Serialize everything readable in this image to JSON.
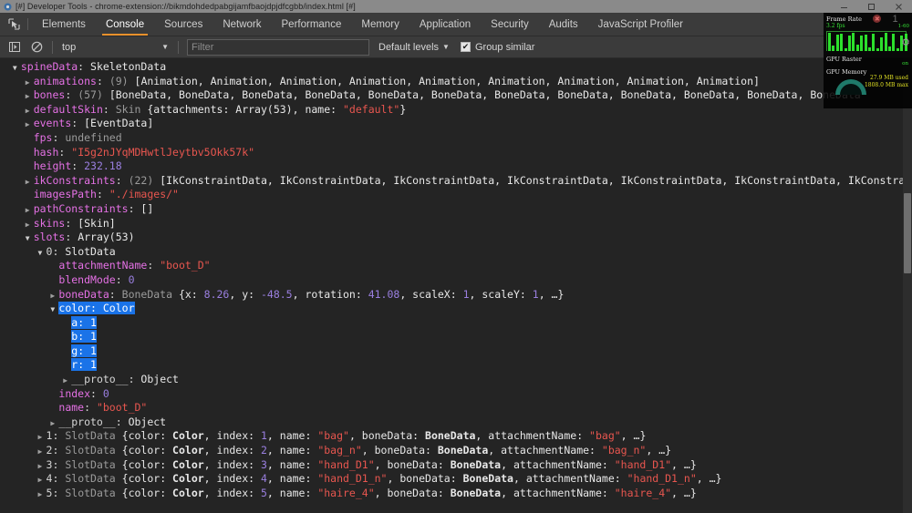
{
  "window": {
    "title": "[#] Developer Tools - chrome-extension://bikmdohdedpabgijamfbaojdpjdfcgbb/index.html [#]",
    "minimize_label": "–",
    "maximize_label": "□",
    "close_label": "✕"
  },
  "tabs": [
    {
      "label": "Elements",
      "active": false
    },
    {
      "label": "Console",
      "active": true
    },
    {
      "label": "Sources",
      "active": false
    },
    {
      "label": "Network",
      "active": false
    },
    {
      "label": "Performance",
      "active": false
    },
    {
      "label": "Memory",
      "active": false
    },
    {
      "label": "Application",
      "active": false
    },
    {
      "label": "Security",
      "active": false
    },
    {
      "label": "Audits",
      "active": false
    },
    {
      "label": "JavaScript Profiler",
      "active": false
    }
  ],
  "filterbar": {
    "execute_icon": "execution-context-icon",
    "clear_icon": "clear-console-icon",
    "context_value": "top",
    "filter_placeholder": "Filter",
    "filter_value": "",
    "levels_label": "Default levels",
    "group_similar_label": "Group similar",
    "group_similar_checked": true,
    "checkmark": "✔"
  },
  "accent_color": "#e8912c",
  "selection_color": "#1a73e8",
  "console": {
    "lines": [
      {
        "indent": 1,
        "arrow": "open",
        "segs": [
          {
            "t": "spineData",
            "c": "k-prop"
          },
          {
            "t": ": ",
            "c": "punct"
          },
          {
            "t": "SkeletonData",
            "c": "v-white"
          }
        ]
      },
      {
        "indent": 2,
        "arrow": "closed",
        "segs": [
          {
            "t": "animations",
            "c": "k-prop"
          },
          {
            "t": ": ",
            "c": "punct"
          },
          {
            "t": "(9) ",
            "c": "v-gray"
          },
          {
            "t": "[Animation, Animation, Animation, Animation, Animation, Animation, Animation, Animation, Animation]",
            "c": "v-white"
          }
        ]
      },
      {
        "indent": 2,
        "arrow": "closed",
        "segs": [
          {
            "t": "bones",
            "c": "k-prop"
          },
          {
            "t": ": ",
            "c": "punct"
          },
          {
            "t": "(57) ",
            "c": "v-gray"
          },
          {
            "t": "[BoneData, BoneData, BoneData, BoneData, BoneData, BoneData, BoneData, BoneData, BoneData, BoneData, BoneData, BoneData",
            "c": "v-white"
          }
        ]
      },
      {
        "indent": 2,
        "arrow": "closed",
        "segs": [
          {
            "t": "defaultSkin",
            "c": "k-prop"
          },
          {
            "t": ": ",
            "c": "punct"
          },
          {
            "t": "Skin ",
            "c": "v-class"
          },
          {
            "t": "{attachments: Array(53), name: ",
            "c": "v-white"
          },
          {
            "t": "\"default\"",
            "c": "v-str"
          },
          {
            "t": "}",
            "c": "v-white"
          }
        ]
      },
      {
        "indent": 2,
        "arrow": "closed",
        "segs": [
          {
            "t": "events",
            "c": "k-prop"
          },
          {
            "t": ": ",
            "c": "punct"
          },
          {
            "t": "[EventData]",
            "c": "v-white"
          }
        ]
      },
      {
        "indent": 2,
        "arrow": "none",
        "segs": [
          {
            "t": "fps",
            "c": "k-prop"
          },
          {
            "t": ": ",
            "c": "punct"
          },
          {
            "t": "undefined",
            "c": "v-gray"
          }
        ]
      },
      {
        "indent": 2,
        "arrow": "none",
        "segs": [
          {
            "t": "hash",
            "c": "k-prop"
          },
          {
            "t": ": ",
            "c": "punct"
          },
          {
            "t": "\"I5g2nJYqMDHwtlJeytbv5Okk57k\"",
            "c": "v-str"
          }
        ]
      },
      {
        "indent": 2,
        "arrow": "none",
        "segs": [
          {
            "t": "height",
            "c": "k-prop"
          },
          {
            "t": ": ",
            "c": "punct"
          },
          {
            "t": "232.18",
            "c": "v-num"
          }
        ]
      },
      {
        "indent": 2,
        "arrow": "closed",
        "segs": [
          {
            "t": "ikConstraints",
            "c": "k-prop"
          },
          {
            "t": ": ",
            "c": "punct"
          },
          {
            "t": "(22) ",
            "c": "v-gray"
          },
          {
            "t": "[IkConstraintData, IkConstraintData, IkConstraintData, IkConstraintData, IkConstraintData, IkConstraintData, IkConstraint",
            "c": "v-white"
          }
        ]
      },
      {
        "indent": 2,
        "arrow": "none",
        "segs": [
          {
            "t": "imagesPath",
            "c": "k-prop"
          },
          {
            "t": ": ",
            "c": "punct"
          },
          {
            "t": "\"./images/\"",
            "c": "v-str"
          }
        ]
      },
      {
        "indent": 2,
        "arrow": "closed",
        "segs": [
          {
            "t": "pathConstraints",
            "c": "k-prop"
          },
          {
            "t": ": ",
            "c": "punct"
          },
          {
            "t": "[]",
            "c": "v-white"
          }
        ]
      },
      {
        "indent": 2,
        "arrow": "closed",
        "segs": [
          {
            "t": "skins",
            "c": "k-prop"
          },
          {
            "t": ": ",
            "c": "punct"
          },
          {
            "t": "[Skin]",
            "c": "v-white"
          }
        ]
      },
      {
        "indent": 2,
        "arrow": "open",
        "segs": [
          {
            "t": "slots",
            "c": "k-prop"
          },
          {
            "t": ": ",
            "c": "punct"
          },
          {
            "t": "Array(53)",
            "c": "v-white"
          }
        ]
      },
      {
        "indent": 3,
        "arrow": "open",
        "segs": [
          {
            "t": "0",
            "c": "k-idx"
          },
          {
            "t": ": ",
            "c": "punct"
          },
          {
            "t": "SlotData",
            "c": "v-white"
          }
        ]
      },
      {
        "indent": 4,
        "arrow": "none",
        "segs": [
          {
            "t": "attachmentName",
            "c": "k-prop"
          },
          {
            "t": ": ",
            "c": "punct"
          },
          {
            "t": "\"boot_D\"",
            "c": "v-str"
          }
        ]
      },
      {
        "indent": 4,
        "arrow": "none",
        "segs": [
          {
            "t": "blendMode",
            "c": "k-prop"
          },
          {
            "t": ": ",
            "c": "punct"
          },
          {
            "t": "0",
            "c": "v-num"
          }
        ]
      },
      {
        "indent": 4,
        "arrow": "closed",
        "segs": [
          {
            "t": "boneData",
            "c": "k-prop"
          },
          {
            "t": ": ",
            "c": "punct"
          },
          {
            "t": "BoneData ",
            "c": "v-class"
          },
          {
            "t": "{x: ",
            "c": "v-white"
          },
          {
            "t": "8.26",
            "c": "v-num"
          },
          {
            "t": ", y: ",
            "c": "v-white"
          },
          {
            "t": "-48.5",
            "c": "v-num"
          },
          {
            "t": ", rotation: ",
            "c": "v-white"
          },
          {
            "t": "41.08",
            "c": "v-num"
          },
          {
            "t": ", scaleX: ",
            "c": "v-white"
          },
          {
            "t": "1",
            "c": "v-num"
          },
          {
            "t": ", scaleY: ",
            "c": "v-white"
          },
          {
            "t": "1",
            "c": "v-num"
          },
          {
            "t": ", …}",
            "c": "v-white"
          }
        ]
      },
      {
        "indent": 4,
        "arrow": "open",
        "selected": true,
        "segs": [
          {
            "t": "color",
            "c": "k-prop"
          },
          {
            "t": ": ",
            "c": "punct"
          },
          {
            "t": "Color",
            "c": "v-white"
          }
        ]
      },
      {
        "indent": 5,
        "arrow": "none",
        "selected": true,
        "segs": [
          {
            "t": "a",
            "c": "k-prop"
          },
          {
            "t": ": ",
            "c": "punct"
          },
          {
            "t": "1",
            "c": "v-num"
          }
        ]
      },
      {
        "indent": 5,
        "arrow": "none",
        "selected": true,
        "segs": [
          {
            "t": "b",
            "c": "k-prop"
          },
          {
            "t": ": ",
            "c": "punct"
          },
          {
            "t": "1",
            "c": "v-num"
          }
        ]
      },
      {
        "indent": 5,
        "arrow": "none",
        "selected": true,
        "segs": [
          {
            "t": "g",
            "c": "k-prop"
          },
          {
            "t": ": ",
            "c": "punct"
          },
          {
            "t": "1",
            "c": "v-num"
          }
        ]
      },
      {
        "indent": 5,
        "arrow": "none",
        "selected": true,
        "segs": [
          {
            "t": "r",
            "c": "k-prop"
          },
          {
            "t": ": ",
            "c": "punct"
          },
          {
            "t": "1",
            "c": "v-num"
          }
        ]
      },
      {
        "indent": 5,
        "arrow": "closed",
        "segs": [
          {
            "t": "__proto__",
            "c": "k-proto"
          },
          {
            "t": ": ",
            "c": "punct"
          },
          {
            "t": "Object",
            "c": "v-white"
          }
        ]
      },
      {
        "indent": 4,
        "arrow": "none",
        "segs": [
          {
            "t": "index",
            "c": "k-prop"
          },
          {
            "t": ": ",
            "c": "punct"
          },
          {
            "t": "0",
            "c": "v-num"
          }
        ]
      },
      {
        "indent": 4,
        "arrow": "none",
        "segs": [
          {
            "t": "name",
            "c": "k-prop"
          },
          {
            "t": ": ",
            "c": "punct"
          },
          {
            "t": "\"boot_D\"",
            "c": "v-str"
          }
        ]
      },
      {
        "indent": 4,
        "arrow": "closed",
        "segs": [
          {
            "t": "__proto__",
            "c": "k-proto"
          },
          {
            "t": ": ",
            "c": "punct"
          },
          {
            "t": "Object",
            "c": "v-white"
          }
        ]
      },
      {
        "indent": 3,
        "arrow": "closed",
        "segs": [
          {
            "t": "1",
            "c": "k-idx"
          },
          {
            "t": ": ",
            "c": "punct"
          },
          {
            "t": "SlotData ",
            "c": "v-class"
          },
          {
            "t": "{color: ",
            "c": "v-white"
          },
          {
            "t": "Color",
            "c": "v-bold"
          },
          {
            "t": ", index: ",
            "c": "v-white"
          },
          {
            "t": "1",
            "c": "v-num"
          },
          {
            "t": ", name: ",
            "c": "v-white"
          },
          {
            "t": "\"bag\"",
            "c": "v-str"
          },
          {
            "t": ", boneData: ",
            "c": "v-white"
          },
          {
            "t": "BoneData",
            "c": "v-bold"
          },
          {
            "t": ", attachmentName: ",
            "c": "v-white"
          },
          {
            "t": "\"bag\"",
            "c": "v-str"
          },
          {
            "t": ", …}",
            "c": "v-white"
          }
        ]
      },
      {
        "indent": 3,
        "arrow": "closed",
        "segs": [
          {
            "t": "2",
            "c": "k-idx"
          },
          {
            "t": ": ",
            "c": "punct"
          },
          {
            "t": "SlotData ",
            "c": "v-class"
          },
          {
            "t": "{color: ",
            "c": "v-white"
          },
          {
            "t": "Color",
            "c": "v-bold"
          },
          {
            "t": ", index: ",
            "c": "v-white"
          },
          {
            "t": "2",
            "c": "v-num"
          },
          {
            "t": ", name: ",
            "c": "v-white"
          },
          {
            "t": "\"bag_n\"",
            "c": "v-str"
          },
          {
            "t": ", boneData: ",
            "c": "v-white"
          },
          {
            "t": "BoneData",
            "c": "v-bold"
          },
          {
            "t": ", attachmentName: ",
            "c": "v-white"
          },
          {
            "t": "\"bag_n\"",
            "c": "v-str"
          },
          {
            "t": ", …}",
            "c": "v-white"
          }
        ]
      },
      {
        "indent": 3,
        "arrow": "closed",
        "segs": [
          {
            "t": "3",
            "c": "k-idx"
          },
          {
            "t": ": ",
            "c": "punct"
          },
          {
            "t": "SlotData ",
            "c": "v-class"
          },
          {
            "t": "{color: ",
            "c": "v-white"
          },
          {
            "t": "Color",
            "c": "v-bold"
          },
          {
            "t": ", index: ",
            "c": "v-white"
          },
          {
            "t": "3",
            "c": "v-num"
          },
          {
            "t": ", name: ",
            "c": "v-white"
          },
          {
            "t": "\"hand_D1\"",
            "c": "v-str"
          },
          {
            "t": ", boneData: ",
            "c": "v-white"
          },
          {
            "t": "BoneData",
            "c": "v-bold"
          },
          {
            "t": ", attachmentName: ",
            "c": "v-white"
          },
          {
            "t": "\"hand_D1\"",
            "c": "v-str"
          },
          {
            "t": ", …}",
            "c": "v-white"
          }
        ]
      },
      {
        "indent": 3,
        "arrow": "closed",
        "segs": [
          {
            "t": "4",
            "c": "k-idx"
          },
          {
            "t": ": ",
            "c": "punct"
          },
          {
            "t": "SlotData ",
            "c": "v-class"
          },
          {
            "t": "{color: ",
            "c": "v-white"
          },
          {
            "t": "Color",
            "c": "v-bold"
          },
          {
            "t": ", index: ",
            "c": "v-white"
          },
          {
            "t": "4",
            "c": "v-num"
          },
          {
            "t": ", name: ",
            "c": "v-white"
          },
          {
            "t": "\"hand_D1_n\"",
            "c": "v-str"
          },
          {
            "t": ", boneData: ",
            "c": "v-white"
          },
          {
            "t": "BoneData",
            "c": "v-bold"
          },
          {
            "t": ", attachmentName: ",
            "c": "v-white"
          },
          {
            "t": "\"hand_D1_n\"",
            "c": "v-str"
          },
          {
            "t": ", …}",
            "c": "v-white"
          }
        ]
      },
      {
        "indent": 3,
        "arrow": "closed",
        "segs": [
          {
            "t": "5",
            "c": "k-idx"
          },
          {
            "t": ": ",
            "c": "punct"
          },
          {
            "t": "SlotData ",
            "c": "v-class"
          },
          {
            "t": "{color: ",
            "c": "v-white"
          },
          {
            "t": "Color",
            "c": "v-bold"
          },
          {
            "t": ", index: ",
            "c": "v-white"
          },
          {
            "t": "5",
            "c": "v-num"
          },
          {
            "t": ", name: ",
            "c": "v-white"
          },
          {
            "t": "\"haire_4\"",
            "c": "v-str"
          },
          {
            "t": ", boneData: ",
            "c": "v-white"
          },
          {
            "t": "BoneData",
            "c": "v-bold"
          },
          {
            "t": ", attachmentName: ",
            "c": "v-white"
          },
          {
            "t": "\"haire_4\"",
            "c": "v-str"
          },
          {
            "t": ", …}",
            "c": "v-white"
          }
        ]
      }
    ]
  },
  "fpsmeter": {
    "frame_rate_label": "Frame Rate",
    "frame_rate_value": "3.2 fps",
    "frame_rate_range": "1-60",
    "frame_rate_big": "1",
    "gpu_raster_label": "GPU Raster",
    "gpu_raster_state": "on",
    "gpu_memory_label": "GPU Memory",
    "gpu_memory_used": "27.9 MB used",
    "gpu_memory_max": "1808.0 MB max",
    "bars": [
      60,
      18,
      55,
      58,
      10,
      50,
      60,
      20,
      52,
      54,
      12,
      58,
      10,
      46,
      60,
      14,
      56,
      9,
      52,
      58
    ],
    "graph_color": "#2ce02c",
    "mem_color": "#e0e024"
  }
}
